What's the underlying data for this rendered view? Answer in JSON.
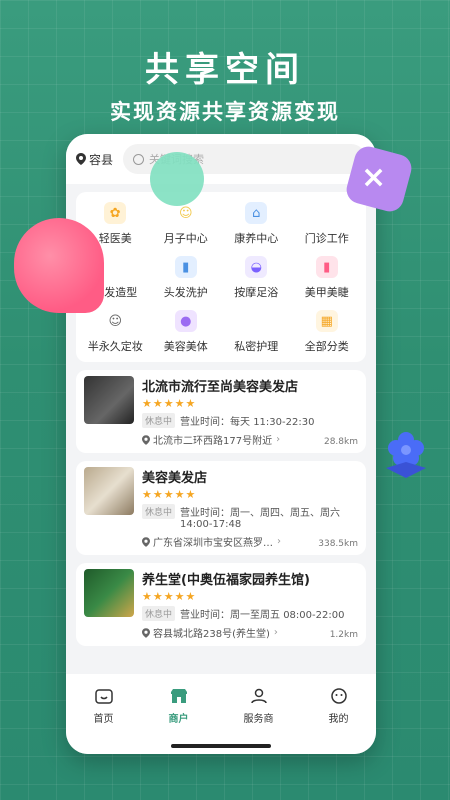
{
  "promo": {
    "title": "共享空间",
    "subtitle": "实现资源共享资源变现"
  },
  "header": {
    "location": "容县",
    "search_placeholder": "关键词搜索"
  },
  "categories": [
    {
      "label": "轻医美",
      "icon": "medical-beauty-icon",
      "color": "#f5a623"
    },
    {
      "label": "月子中心",
      "icon": "baby-icon",
      "color": "#f2c94c"
    },
    {
      "label": "康养中心",
      "icon": "house-icon",
      "color": "#4a90e2"
    },
    {
      "label": "门诊工作",
      "icon": "clinic-icon",
      "color": "#ffffff"
    },
    {
      "label": "剪发造型",
      "icon": "haircut-icon",
      "color": "#ffffff"
    },
    {
      "label": "头发洗护",
      "icon": "shampoo-icon",
      "color": "#4a90e2"
    },
    {
      "label": "按摩足浴",
      "icon": "massage-icon",
      "color": "#7b61ff"
    },
    {
      "label": "美甲美睫",
      "icon": "nail-polish-icon",
      "color": "#ff5c85"
    },
    {
      "label": "半永久定妆",
      "icon": "eyebrow-icon",
      "color": "#ffffff"
    },
    {
      "label": "美容美体",
      "icon": "face-mask-icon",
      "color": "#9b6bf2"
    },
    {
      "label": "私密护理",
      "icon": "care-icon",
      "color": "#ffffff"
    },
    {
      "label": "全部分类",
      "icon": "grid-icon",
      "color": "#f5a623"
    }
  ],
  "shops": [
    {
      "name": "北流市流行至尚美容美发店",
      "stars": "★★★★★",
      "status": "休息中",
      "hours": "营业时间：每天 11:30-22:30",
      "address": "北流市二环西路177号附近",
      "distance": "28.8km"
    },
    {
      "name": "美容美发店",
      "stars": "★★★★★",
      "status": "休息中",
      "hours": "营业时间：周一、周四、周五、周六 14:00-17:48",
      "address": "广东省深圳市宝安区燕罗…",
      "distance": "338.5km"
    },
    {
      "name": "养生堂(中奥伍福家园养生馆)",
      "stars": "★★★★★",
      "status": "休息中",
      "hours": "营业时间：周一至周五 08:00-22:00",
      "address": "容县城北路238号(养生堂)",
      "distance": "1.2km"
    }
  ],
  "tabs": [
    {
      "label": "首页",
      "icon": "home-icon",
      "active": false
    },
    {
      "label": "商户",
      "icon": "store-icon",
      "active": true
    },
    {
      "label": "服务商",
      "icon": "person-icon",
      "active": false
    },
    {
      "label": "我的",
      "icon": "smiley-icon",
      "active": false
    }
  ],
  "colors": {
    "brand": "#3a9c7e",
    "star": "#f5a623"
  }
}
